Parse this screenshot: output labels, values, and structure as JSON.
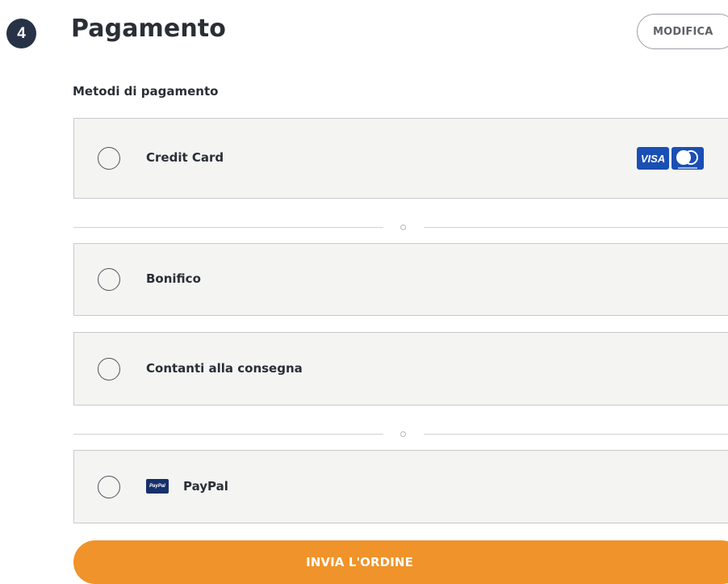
{
  "step": {
    "number": "4",
    "title": "Pagamento",
    "modify_label": "MODIFICA"
  },
  "payment": {
    "section_label": "Metodi di pagamento",
    "options": [
      {
        "label": "Credit Card",
        "selected": false,
        "icons": [
          "visa-icon",
          "mastercard-icon"
        ],
        "visa_text": "VISA"
      },
      {
        "label": "Bonifico",
        "selected": false
      },
      {
        "label": "Contanti alla consegna",
        "selected": false
      },
      {
        "label": "PayPal",
        "selected": false,
        "icons": [
          "paypal-icon"
        ],
        "paypal_text": "PayPal"
      }
    ],
    "divider_symbol": "o"
  },
  "actions": {
    "submit_label": "INVIA L'ORDINE"
  },
  "colors": {
    "badge_bg": "#273246",
    "accent_orange": "#f0932a",
    "option_bg": "#f4f4f3",
    "option_border": "#c9c9c7",
    "card_blue": "#1a4fb3",
    "paypal_blue": "#16306b"
  }
}
